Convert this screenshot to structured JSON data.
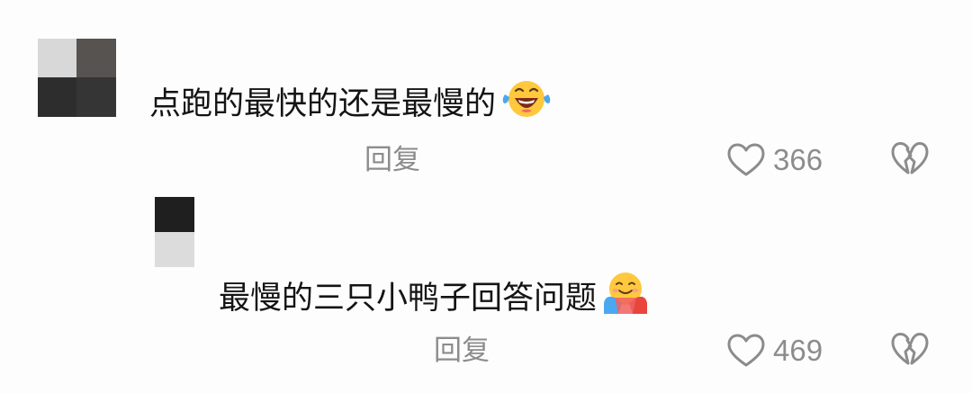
{
  "comments": [
    {
      "text": "点跑的最快的还是最慢的",
      "emoji_icon": "laughing-crying-face-icon",
      "reply_label": "回复",
      "like_count": "366"
    },
    {
      "text": "最慢的三只小鸭子回答问题",
      "emoji_icon": "hugging-face-icon",
      "reply_label": "回复",
      "like_count": "469"
    }
  ],
  "colors": {
    "text": "#141414",
    "muted": "#8c8c8c",
    "background": "#fdfdfd"
  }
}
